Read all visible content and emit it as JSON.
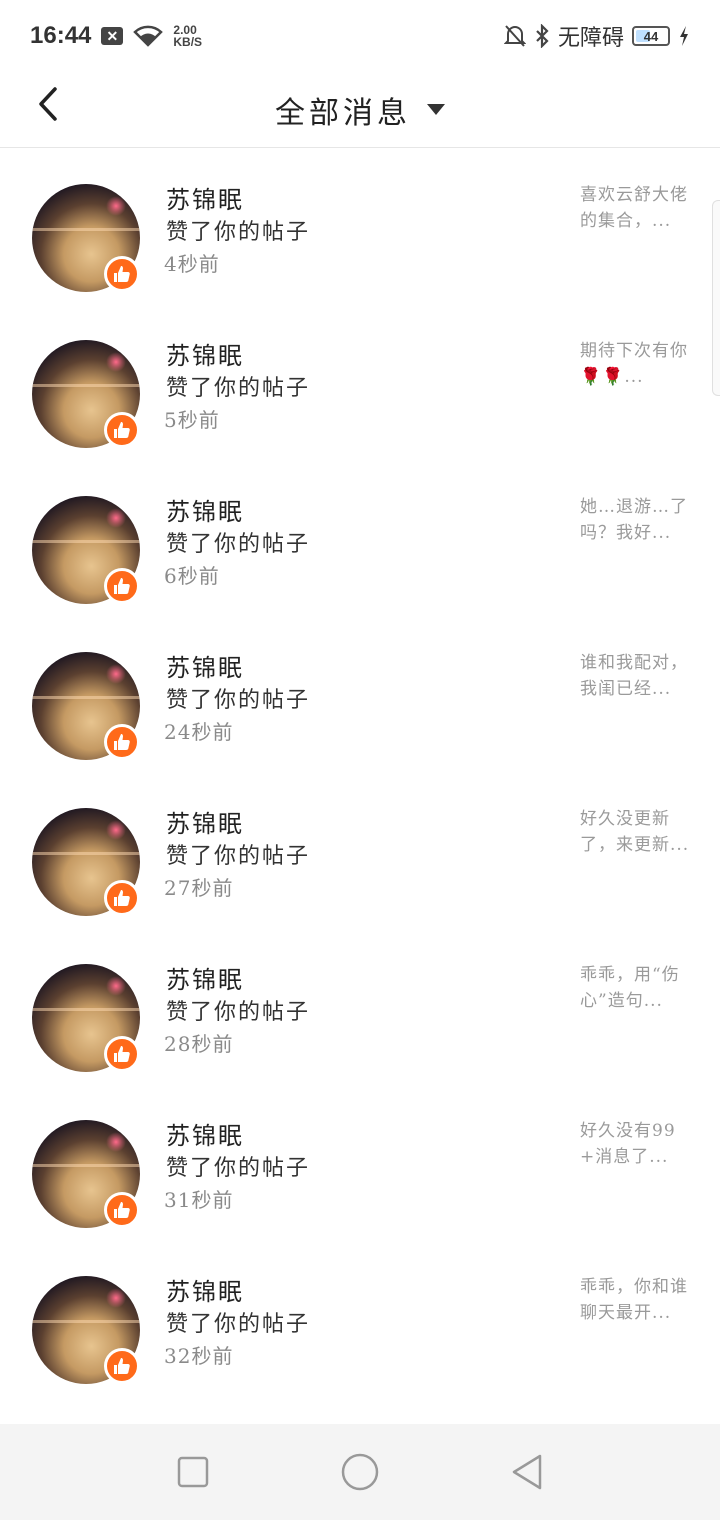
{
  "status_bar": {
    "time": "16:44",
    "speed_value": "2.00",
    "speed_unit": "KB/S",
    "accessibility_label": "无障碍",
    "battery": "44"
  },
  "header": {
    "title": "全部消息"
  },
  "messages": [
    {
      "name": "苏锦眠",
      "action": "赞了你的帖子",
      "time": "4秒前",
      "preview": "喜欢云舒大佬的集合，..."
    },
    {
      "name": "苏锦眠",
      "action": "赞了你的帖子",
      "time": "5秒前",
      "preview": "期待下次有你🌹🌹..."
    },
    {
      "name": "苏锦眠",
      "action": "赞了你的帖子",
      "time": "6秒前",
      "preview": "她…退游…了吗？我好..."
    },
    {
      "name": "苏锦眠",
      "action": "赞了你的帖子",
      "time": "24秒前",
      "preview": "谁和我配对，我闺已经..."
    },
    {
      "name": "苏锦眠",
      "action": "赞了你的帖子",
      "time": "27秒前",
      "preview": "好久没更新了，来更新..."
    },
    {
      "name": "苏锦眠",
      "action": "赞了你的帖子",
      "time": "28秒前",
      "preview": "乖乖，用“伤心”造句..."
    },
    {
      "name": "苏锦眠",
      "action": "赞了你的帖子",
      "time": "31秒前",
      "preview": "好久没有99+消息了..."
    },
    {
      "name": "苏锦眠",
      "action": "赞了你的帖子",
      "time": "32秒前",
      "preview": "乖乖，你和谁聊天最开..."
    }
  ],
  "colors": {
    "like_badge": "#ff6a1a",
    "nav_bar_bg": "#f4f4f4"
  },
  "icons": {
    "back": "chevron-left-icon",
    "dropdown": "triangle-down-icon",
    "like": "thumbs-up-icon",
    "nav_recent": "square-icon",
    "nav_home": "circle-icon",
    "nav_back": "triangle-left-icon"
  }
}
